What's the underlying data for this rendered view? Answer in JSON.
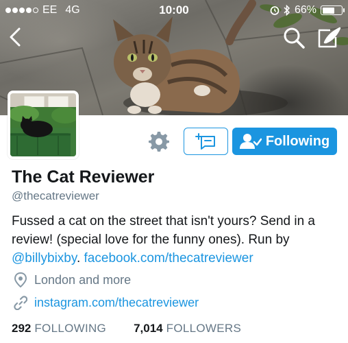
{
  "status_bar": {
    "carrier": "EE",
    "network": "4G",
    "time": "10:00",
    "battery_percent_label": "66%",
    "battery_level": 0.66,
    "icons": [
      "signal-dots-icon",
      "alarm-icon",
      "bluetooth-icon",
      "battery-icon"
    ]
  },
  "nav": {
    "back_icon": "chevron-left-icon",
    "search_icon": "search-icon",
    "compose_icon": "compose-tweet-icon"
  },
  "actions": {
    "settings_icon": "gear-icon",
    "message_icon": "direct-message-icon",
    "follow_label": "Following",
    "follow_icon": "user-check-icon",
    "accent_color": "#1b95e0"
  },
  "profile": {
    "name": "The Cat Reviewer",
    "handle": "@thecatreviewer",
    "bio_text": "Fussed a cat on the street that isn't yours? Send in a review! (special love for the funny ones). Run by ",
    "bio_mention": "@billybixby",
    "bio_separator": ". ",
    "bio_link": "facebook.com/thecatreviewer",
    "location": "London and more",
    "location_icon": "location-pin-icon",
    "website": "instagram.com/thecatreviewer",
    "website_icon": "link-icon"
  },
  "stats": {
    "following_count": "292",
    "following_label": "FOLLOWING",
    "followers_count": "7,014",
    "followers_label": "FOLLOWERS"
  }
}
